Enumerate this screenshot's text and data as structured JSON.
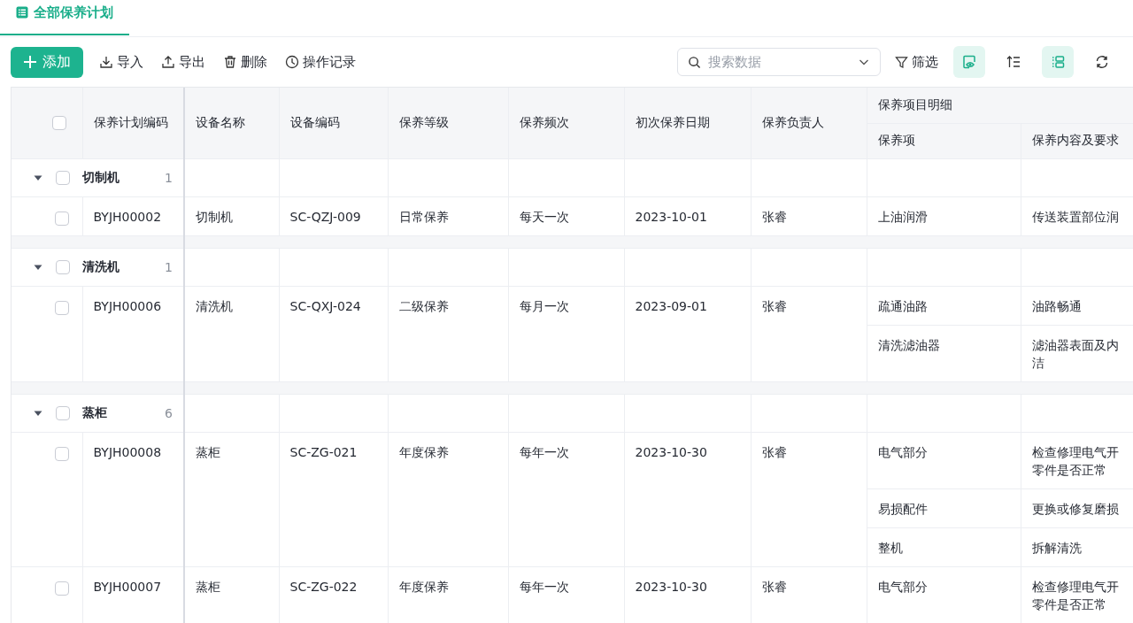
{
  "tabs": [
    {
      "label": "全部保养计划",
      "selected": true
    }
  ],
  "toolbar": {
    "add_button": "添加",
    "actions": [
      {
        "kind": "import",
        "label": "导入"
      },
      {
        "kind": "export",
        "label": "导出"
      },
      {
        "kind": "delete",
        "label": "删除"
      },
      {
        "kind": "history",
        "label": "操作记录"
      }
    ],
    "search": {
      "placeholder": "搜索数据"
    },
    "filter_button": "筛选",
    "icon_buttons": [
      {
        "kind": "view",
        "selected": true
      },
      {
        "kind": "sort",
        "selected": false
      },
      {
        "kind": "group",
        "selected": true
      },
      {
        "kind": "refresh",
        "selected": false
      }
    ]
  },
  "table": {
    "header_checked": false,
    "columns": [
      "保养计划编码",
      "设备名称",
      "设备编码",
      "保养等级",
      "保养频次",
      "初次保养日期",
      "保养负责人"
    ],
    "detail_group": "保养项目明细",
    "detail_columns": [
      "保养项",
      "保养内容及要求"
    ],
    "groups": [
      {
        "name": "切制机",
        "count": "1",
        "expanded": true,
        "checked": false,
        "records": [
          {
            "checked": false,
            "cells": [
              "BYJH00002",
              "切制机",
              "SC-QZJ-009",
              "日常保养",
              "每天一次",
              "2023-10-01",
              "张睿"
            ],
            "items": [
              {
                "item": "上油润滑",
                "content": [
                  "传送装置部位润"
                ]
              }
            ]
          }
        ]
      },
      {
        "name": "清洗机",
        "count": "1",
        "expanded": true,
        "checked": false,
        "records": [
          {
            "checked": false,
            "cells": [
              "BYJH00006",
              "清洗机",
              "SC-QXJ-024",
              "二级保养",
              "每月一次",
              "2023-09-01",
              "张睿"
            ],
            "items": [
              {
                "item": "疏通油路",
                "content": [
                  "油路畅通"
                ]
              },
              {
                "item": "清洗滤油器",
                "content": [
                  "滤油器表面及内",
                  "洁"
                ]
              }
            ]
          }
        ]
      },
      {
        "name": "蒸柜",
        "count": "6",
        "expanded": true,
        "checked": false,
        "records": [
          {
            "checked": false,
            "cells": [
              "BYJH00008",
              "蒸柜",
              "SC-ZG-021",
              "年度保养",
              "每年一次",
              "2023-10-30",
              "张睿"
            ],
            "items": [
              {
                "item": "电气部分",
                "content": [
                  "检查修理电气开",
                  "零件是否正常"
                ]
              },
              {
                "item": "易损配件",
                "content": [
                  "更换或修复磨损"
                ]
              },
              {
                "item": "整机",
                "content": [
                  "拆解清洗"
                ]
              }
            ]
          },
          {
            "checked": false,
            "cells": [
              "BYJH00007",
              "蒸柜",
              "SC-ZG-022",
              "年度保养",
              "每年一次",
              "2023-10-30",
              "张睿"
            ],
            "items": [
              {
                "item": "电气部分",
                "content": [
                  "检查修理电气开",
                  "零件是否正常"
                ]
              }
            ]
          }
        ]
      }
    ]
  }
}
